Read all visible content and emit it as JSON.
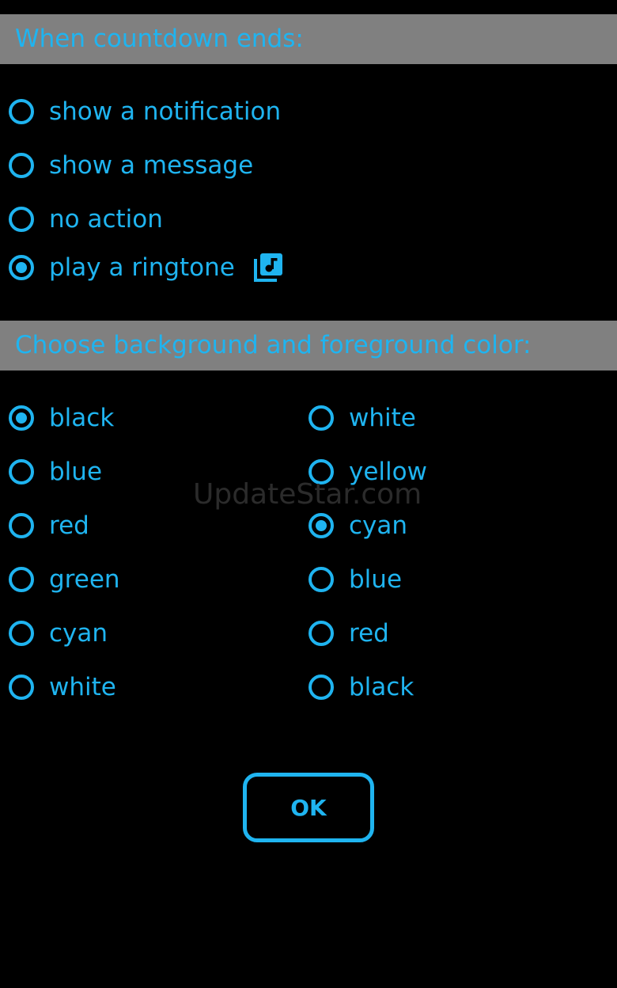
{
  "colors": {
    "background": "#000000",
    "accent": "#1fb4f0",
    "header_bg": "#808080"
  },
  "countdown_section": {
    "header": "When countdown ends:",
    "options": [
      {
        "label": "show a notification",
        "checked": false
      },
      {
        "label": "show a message",
        "checked": false
      },
      {
        "label": "no action",
        "checked": false
      },
      {
        "label": "play a ringtone",
        "checked": true,
        "icon": "music-library-icon"
      }
    ]
  },
  "color_section": {
    "header": "Choose background and foreground color:",
    "background_options": [
      {
        "label": "black",
        "checked": true
      },
      {
        "label": "blue",
        "checked": false
      },
      {
        "label": "red",
        "checked": false
      },
      {
        "label": "green",
        "checked": false
      },
      {
        "label": "cyan",
        "checked": false
      },
      {
        "label": "white",
        "checked": false
      }
    ],
    "foreground_options": [
      {
        "label": "white",
        "checked": false
      },
      {
        "label": "yellow",
        "checked": false
      },
      {
        "label": "cyan",
        "checked": true
      },
      {
        "label": "blue",
        "checked": false
      },
      {
        "label": "red",
        "checked": false
      },
      {
        "label": "black",
        "checked": false
      }
    ]
  },
  "watermark": "UpdateStar.com",
  "ok_button": {
    "label": "OK"
  }
}
